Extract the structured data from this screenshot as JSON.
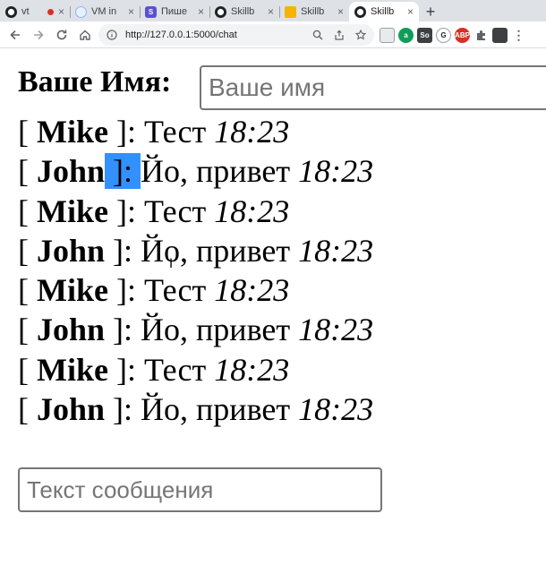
{
  "browser": {
    "tabs": [
      {
        "label": "vt",
        "favicon": "github-icon",
        "recording": true
      },
      {
        "label": "VM in",
        "favicon": "vm-icon"
      },
      {
        "label": "Пише",
        "favicon": "s-icon"
      },
      {
        "label": "Skillb",
        "favicon": "github-icon"
      },
      {
        "label": "Skillb",
        "favicon": "folder-icon"
      },
      {
        "label": "Skillb",
        "favicon": "github-icon",
        "active": true
      }
    ],
    "new_tab_label": "+",
    "tab_close_label": "×",
    "url": "http://127.0.0.1:5000/chat",
    "extensions": [
      "ext-1",
      "ext-2",
      "ext-3",
      "ext-4",
      "abp",
      "puzzle",
      "profile"
    ],
    "colors": {
      "accent": "#1a73e8",
      "selection": "#3390ff"
    }
  },
  "page": {
    "name_label": "Ваше Имя:",
    "name_placeholder": "Ваше имя",
    "message_placeholder": "Текст сообщения",
    "messages": [
      {
        "open": "[ ",
        "user": "Mike",
        "close": " ]: ",
        "text": "Тест ",
        "time": "18:23"
      },
      {
        "open": "[ ",
        "user": "John",
        "close": " ]: ",
        "text": "Йо, привет ",
        "time": "18:23"
      },
      {
        "open": "[ ",
        "user": "Mike",
        "close": " ]: ",
        "text": "Тест ",
        "time": "18:23"
      },
      {
        "open": "[ ",
        "user": "John",
        "close": " ]: ",
        "text": "Йо, привет ",
        "time": "18:23"
      },
      {
        "open": "[ ",
        "user": "Mike",
        "close": " ]: ",
        "text": "Тест ",
        "time": "18:23"
      },
      {
        "open": "[ ",
        "user": "John",
        "close": " ]: ",
        "text": "Йо, привет ",
        "time": "18:23"
      },
      {
        "open": "[ ",
        "user": "Mike",
        "close": " ]: ",
        "text": "Тест ",
        "time": "18:23"
      },
      {
        "open": "[ ",
        "user": "John",
        "close": " ]: ",
        "text": "Йо, привет ",
        "time": "18:23"
      }
    ]
  }
}
